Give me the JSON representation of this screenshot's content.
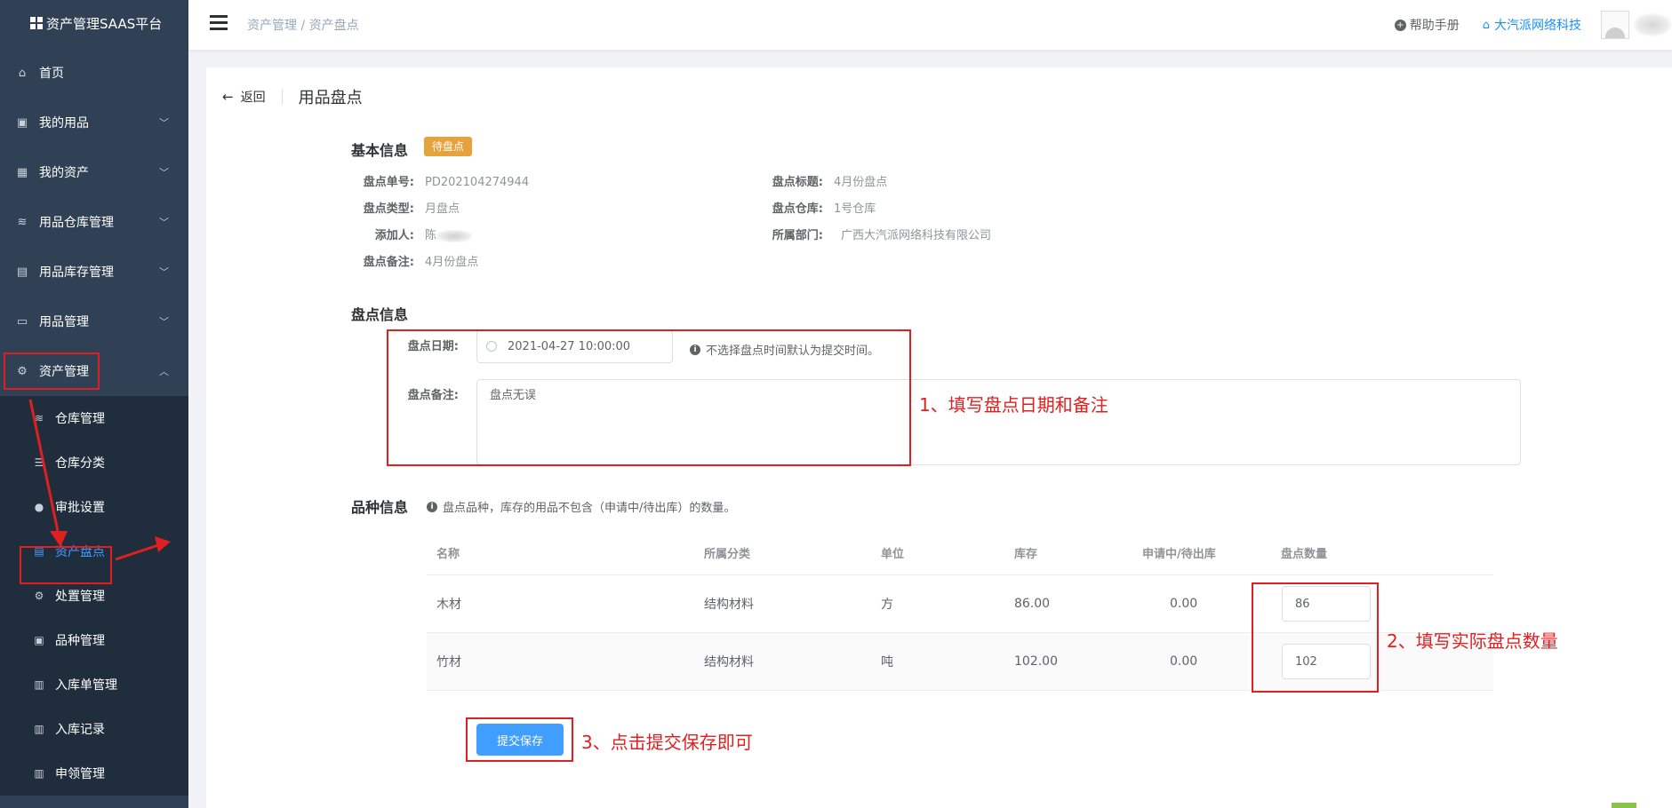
{
  "app": {
    "title": "资产管理SAAS平台"
  },
  "sidebar": {
    "items": [
      {
        "label": "首页",
        "icon": "home-icon"
      },
      {
        "label": "我的用品",
        "icon": "bag-icon"
      },
      {
        "label": "我的资产",
        "icon": "building-icon"
      },
      {
        "label": "用品仓库管理",
        "icon": "database-icon"
      },
      {
        "label": "用品库存管理",
        "icon": "box-icon"
      },
      {
        "label": "用品管理",
        "icon": "inbox-icon"
      },
      {
        "label": "资产管理",
        "icon": "asset-icon"
      }
    ],
    "subitems": [
      {
        "label": "仓库管理"
      },
      {
        "label": "仓库分类"
      },
      {
        "label": "审批设置"
      },
      {
        "label": "资产盘点"
      },
      {
        "label": "处置管理"
      },
      {
        "label": "品种管理"
      },
      {
        "label": "入库单管理"
      },
      {
        "label": "入库记录"
      },
      {
        "label": "申领管理"
      }
    ]
  },
  "header": {
    "breadcrumb": "资产管理 / 资产盘点",
    "help": "帮助手册",
    "company": "大汽派网络科技"
  },
  "page": {
    "back": "返回",
    "title": "用品盘点"
  },
  "basic": {
    "section": "基本信息",
    "status": "待盘点",
    "no_label": "盘点单号:",
    "no": "PD202104274944",
    "title_label": "盘点标题:",
    "title": "4月份盘点",
    "type_label": "盘点类型:",
    "type": "月盘点",
    "warehouse_label": "盘点仓库:",
    "warehouse": "1号仓库",
    "adder_label": "添加人:",
    "adder": "陈",
    "dept_label": "所属部门:",
    "dept": "广西大汽派网络科技有限公司",
    "remark_label": "盘点备注:",
    "remark": "4月份盘点"
  },
  "check": {
    "section": "盘点信息",
    "date_label": "盘点日期:",
    "date": "2021-04-27 10:00:00",
    "date_hint": "不选择盘点时间默认为提交时间。",
    "remark_label": "盘点备注:",
    "remark": "盘点无误"
  },
  "items": {
    "section": "品种信息",
    "hint": "盘点品种，库存的用品不包含（申请中/待出库）的数量。",
    "columns": [
      "名称",
      "所属分类",
      "单位",
      "库存",
      "申请中/待出库",
      "盘点数量"
    ],
    "rows": [
      {
        "name": "木材",
        "category": "结构材料",
        "unit": "方",
        "stock": "86.00",
        "pending": "0.00",
        "qty": "86"
      },
      {
        "name": "竹材",
        "category": "结构材料",
        "unit": "吨",
        "stock": "102.00",
        "pending": "0.00",
        "qty": "102"
      }
    ]
  },
  "submit": "提交保存",
  "annotations": {
    "a1": "1、填写盘点日期和备注",
    "a2": "2、填写实际盘点数量",
    "a3": "3、点击提交保存即可"
  },
  "colors": {
    "accent": "#409eff",
    "annotation": "#e02020",
    "status": "#e6a23c",
    "sidebar": "#304156"
  }
}
